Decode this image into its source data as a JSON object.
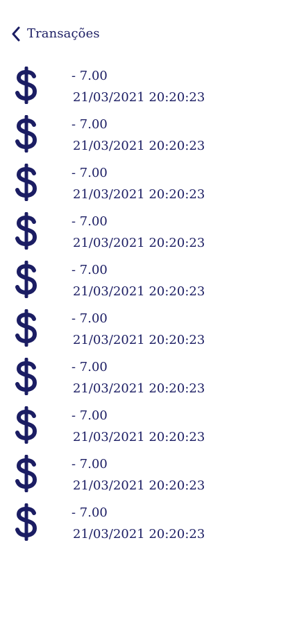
{
  "header": {
    "back_icon": "chevron-left-icon",
    "title": "Transações"
  },
  "colors": {
    "primary": "#1b1d63",
    "background": "#ffffff"
  },
  "transactions": [
    {
      "icon": "dollar-icon",
      "amount": "- 7.00",
      "datetime": "21/03/2021 20:20:23"
    },
    {
      "icon": "dollar-icon",
      "amount": "- 7.00",
      "datetime": "21/03/2021 20:20:23"
    },
    {
      "icon": "dollar-icon",
      "amount": "- 7.00",
      "datetime": "21/03/2021 20:20:23"
    },
    {
      "icon": "dollar-icon",
      "amount": "- 7.00",
      "datetime": "21/03/2021 20:20:23"
    },
    {
      "icon": "dollar-icon",
      "amount": "- 7.00",
      "datetime": "21/03/2021 20:20:23"
    },
    {
      "icon": "dollar-icon",
      "amount": "- 7.00",
      "datetime": "21/03/2021 20:20:23"
    },
    {
      "icon": "dollar-icon",
      "amount": "- 7.00",
      "datetime": "21/03/2021 20:20:23"
    },
    {
      "icon": "dollar-icon",
      "amount": "- 7.00",
      "datetime": "21/03/2021 20:20:23"
    },
    {
      "icon": "dollar-icon",
      "amount": "- 7.00",
      "datetime": "21/03/2021 20:20:23"
    },
    {
      "icon": "dollar-icon",
      "amount": "- 7.00",
      "datetime": "21/03/2021 20:20:23"
    }
  ]
}
